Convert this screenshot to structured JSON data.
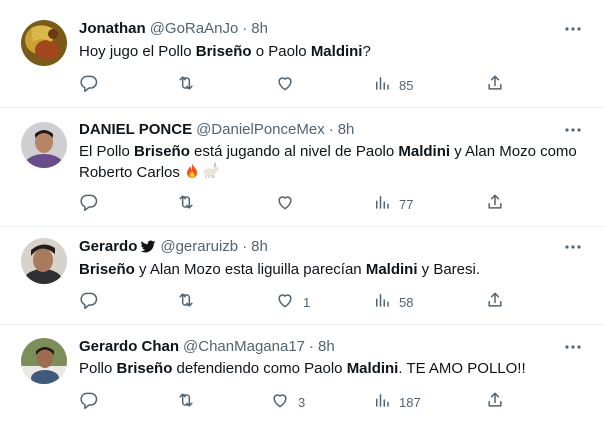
{
  "tweets": [
    {
      "display_name": "Jonathan",
      "handle": "@GoRaAnJo",
      "separator": "·",
      "time": "8h",
      "text_parts": [
        {
          "t": "Hoy jugo el Pollo ",
          "b": false
        },
        {
          "t": "Briseño",
          "b": true
        },
        {
          "t": " o Paolo ",
          "b": false
        },
        {
          "t": "Maldini",
          "b": true
        },
        {
          "t": "?",
          "b": false
        }
      ],
      "reply_count": "",
      "retweet_count": "",
      "like_count": "",
      "view_count": "85",
      "avatar_color": "#8b6a1d"
    },
    {
      "display_name": "DANIEL PONCE",
      "handle": "@DanielPonceMex",
      "separator": "·",
      "time": "8h",
      "text_parts": [
        {
          "t": "El Pollo ",
          "b": false
        },
        {
          "t": "Briseño",
          "b": true
        },
        {
          "t": " está jugando al nivel de Paolo ",
          "b": false
        },
        {
          "t": "Maldini",
          "b": true
        },
        {
          "t": " y Alan Mozo como Roberto Carlos ",
          "b": false
        }
      ],
      "emojis": [
        "fire-emoji",
        "goat-emoji"
      ],
      "reply_count": "",
      "retweet_count": "",
      "like_count": "",
      "view_count": "77",
      "avatar_color": "#3c3a3f"
    },
    {
      "display_name": "Gerardo",
      "handle": "@geraruizb",
      "separator": "·",
      "time": "8h",
      "verified_icon": "twitter-bird-icon",
      "text_parts": [
        {
          "t": "Briseño",
          "b": true
        },
        {
          "t": " y Alan Mozo esta liguilla parecían ",
          "b": false
        },
        {
          "t": "Maldini",
          "b": true
        },
        {
          "t": " y Baresi.",
          "b": false
        }
      ],
      "reply_count": "",
      "retweet_count": "",
      "like_count": "1",
      "view_count": "58",
      "avatar_color": "#4a4036"
    },
    {
      "display_name": "Gerardo Chan",
      "handle": "@ChanMagana17",
      "separator": "·",
      "time": "8h",
      "text_parts": [
        {
          "t": "Pollo ",
          "b": false
        },
        {
          "t": "Briseño",
          "b": true
        },
        {
          "t": " defendiendo como Paolo ",
          "b": false
        },
        {
          "t": "Maldini",
          "b": true
        },
        {
          "t": ". TE AMO POLLO!!",
          "b": false
        }
      ],
      "reply_count": "",
      "retweet_count": "",
      "like_count": "3",
      "view_count": "187",
      "avatar_color": "#5a6b3a"
    }
  ],
  "colors": {
    "text": "#0f1419",
    "secondary": "#536471",
    "divider": "#eff3f4"
  },
  "icons": [
    "reply-icon",
    "retweet-icon",
    "like-icon",
    "views-icon",
    "share-icon",
    "more-icon"
  ]
}
